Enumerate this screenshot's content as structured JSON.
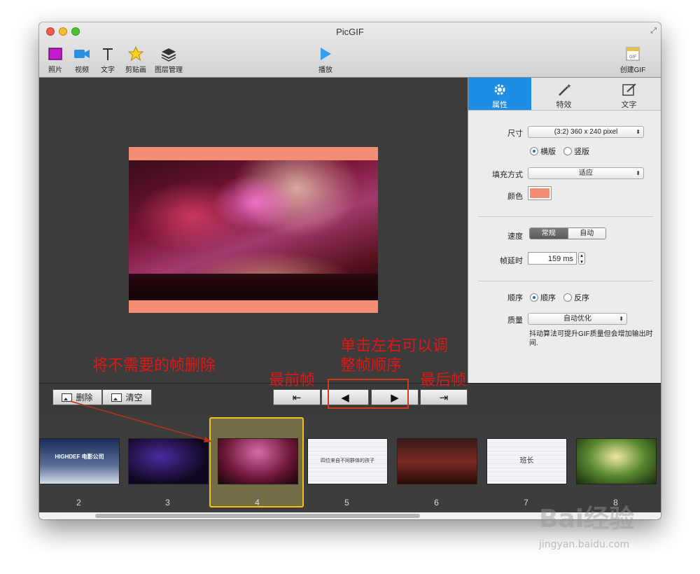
{
  "window": {
    "title": "PicGIF"
  },
  "toolbar": {
    "items": [
      {
        "label": "照片",
        "icon": "photo-icon"
      },
      {
        "label": "视频",
        "icon": "video-icon"
      },
      {
        "label": "文字",
        "icon": "text-icon"
      },
      {
        "label": "剪贴画",
        "icon": "star-icon"
      },
      {
        "label": "图层管理",
        "icon": "layers-icon"
      }
    ],
    "play_label": "播放",
    "create_label": "创建GIF",
    "create_icon_text": "GIF"
  },
  "panel": {
    "tabs": [
      {
        "label": "属性",
        "icon": "gear-icon",
        "active": true
      },
      {
        "label": "特效",
        "icon": "magic-wand-icon",
        "active": false
      },
      {
        "label": "文字",
        "icon": "edit-icon",
        "active": false
      }
    ],
    "size_label": "尺寸",
    "size_value": "(3:2) 360 x 240 pixel",
    "orientation_options": [
      "横版",
      "竖版"
    ],
    "orientation_selected": "横版",
    "fill_label": "填充方式",
    "fill_value": "适应",
    "color_label": "颜色",
    "color_value": "#f38d74",
    "speed_label": "速度",
    "speed_options": [
      "常规",
      "自动"
    ],
    "speed_selected": "常规",
    "delay_label": "帧延时",
    "delay_value": "159 ms",
    "order_label": "顺序",
    "order_options": [
      "顺序",
      "反序"
    ],
    "order_selected": "顺序",
    "quality_label": "质量",
    "quality_value": "自动优化",
    "quality_note": "抖动算法可提升GIF质量但会增加输出时间."
  },
  "bottombar": {
    "delete_label": "删除",
    "clear_label": "清空"
  },
  "frames": [
    {
      "number": "2",
      "caption": "HIGHDEF 电影公司"
    },
    {
      "number": "3",
      "caption": ""
    },
    {
      "number": "4",
      "caption": "",
      "selected": true
    },
    {
      "number": "5",
      "caption": "四位来自不同群体的孩子"
    },
    {
      "number": "6",
      "caption": ""
    },
    {
      "number": "7",
      "caption": "班长"
    },
    {
      "number": "8",
      "caption": ""
    }
  ],
  "annotations": {
    "delete_hint": "将不需要的帧删除",
    "reorder_hint_line1": "单击左右可以调",
    "reorder_hint_line2": "整帧顺序",
    "first_frame": "最前帧",
    "last_frame": "最后帧"
  },
  "watermark": {
    "main": "Bai经验",
    "url": "jingyan.baidu.com"
  }
}
